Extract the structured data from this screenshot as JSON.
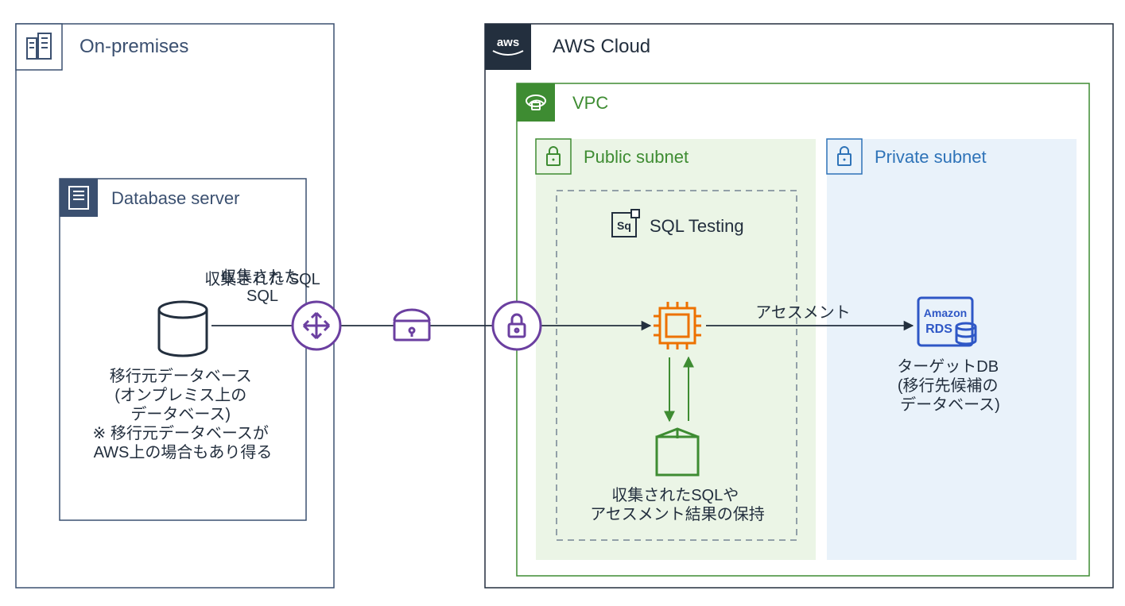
{
  "onprem": {
    "title": "On-premises",
    "db_server_title": "Database server",
    "sql_label": "収集された\nSQL",
    "source_db_label": "移行元データベース\n(オンプレミス上の\nデータベース)\n※ 移行元データベースが\nAWS上の場合もあり得る"
  },
  "aws": {
    "title": "AWS Cloud",
    "vpc_title": "VPC",
    "public_subnet_title": "Public subnet",
    "private_subnet_title": "Private subnet",
    "sql_testing_label": "SQL Testing",
    "assessment_label": "アセスメント",
    "storage_label": "収集されたSQLや\nアセスメント結果の保持",
    "rds_name": "Amazon",
    "rds_sub": "RDS",
    "target_db_label": "ターゲットDB\n(移行先候補の\nデータベース)"
  },
  "colors": {
    "navy": "#3B5070",
    "black": "#232F3E",
    "green": "#3E8C32",
    "green_fill": "#EBF5E6",
    "blue": "#2E73B8",
    "blue_fill": "#E9F2FA",
    "orange": "#ED7100",
    "purple": "#6B3FA0",
    "gray_dash": "#748494"
  }
}
